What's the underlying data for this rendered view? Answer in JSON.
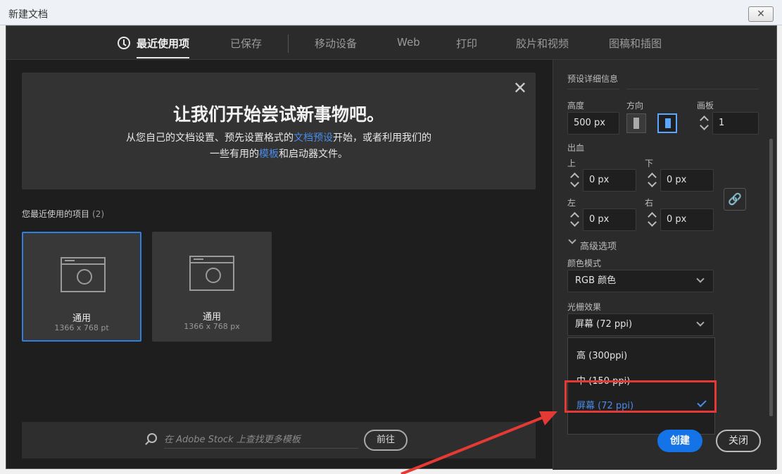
{
  "window": {
    "title": "新建文档",
    "close_glyph": "✕"
  },
  "tabs": [
    {
      "label": "最近使用项",
      "active": true
    },
    {
      "label": "已保存"
    },
    {
      "label": "移动设备"
    },
    {
      "label": "Web"
    },
    {
      "label": "打印"
    },
    {
      "label": "胶片和视频"
    },
    {
      "label": "图稿和插图"
    }
  ],
  "banner": {
    "title": "让我们开始尝试新事物吧。",
    "line1_a": "从您自己的文档设置、预先设置格式的",
    "line1_link": "文档预设",
    "line1_b": "开始，或者利用我们的",
    "line2_a": "一些有用的",
    "line2_link": "模板",
    "line2_b": "和启动器文件。",
    "close_glyph": "✕"
  },
  "recent": {
    "label": "您最近使用的项目",
    "count": "(2)",
    "items": [
      {
        "name": "通用",
        "size": "1366 x 768 pt",
        "selected": true
      },
      {
        "name": "通用",
        "size": "1366 x 768 px"
      }
    ]
  },
  "stock": {
    "placeholder": "在 Adobe Stock 上查找更多模板",
    "go_label": "前往"
  },
  "panel": {
    "preset_label": "预设详细信息",
    "height_label": "高度",
    "height_value": "500 px",
    "orientation_label": "方向",
    "artboard_label": "画板",
    "artboard_value": "1",
    "bleed_label": "出血",
    "top_label": "上",
    "top_value": "0 px",
    "bottom_label": "下",
    "bottom_value": "0 px",
    "left_label": "左",
    "left_value": "0 px",
    "right_label": "右",
    "right_value": "0 px",
    "advanced_label": "高级选项",
    "color_mode_label": "颜色模式",
    "color_mode_value": "RGB 颜色",
    "raster_label": "光栅效果",
    "raster_value": "屏幕 (72 ppi)",
    "raster_options": [
      "高 (300ppi)",
      "中 (150 ppi)",
      "屏幕 (72 ppi)"
    ],
    "link_glyph": "🔗"
  },
  "actions": {
    "create": "创建",
    "close": "关闭"
  },
  "colors": {
    "accent": "#1473e6",
    "link": "#4a8be8",
    "highlight": "#e53935"
  }
}
